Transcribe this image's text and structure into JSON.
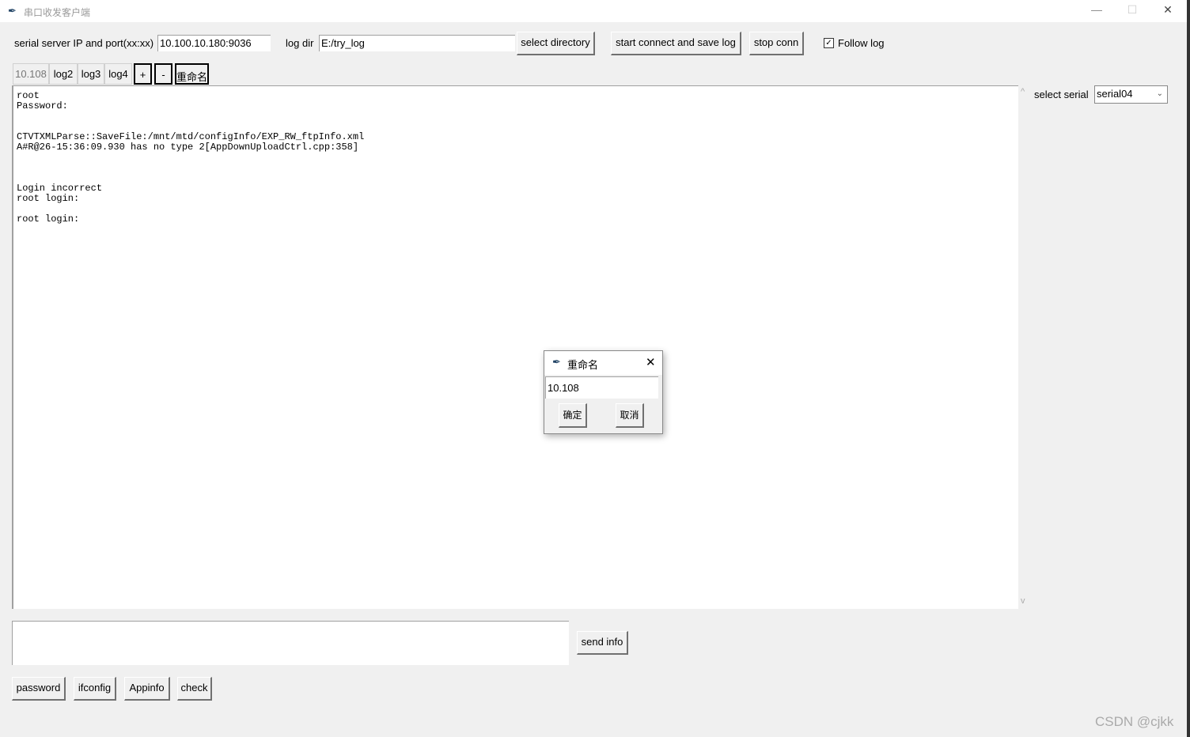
{
  "window": {
    "title": "串口收发客户端",
    "minimize": "—",
    "maximize": "☐",
    "close": "✕"
  },
  "toolbar": {
    "ip_label": "serial server IP and port(xx:xx)",
    "ip_value": "10.100.10.180:9036",
    "logdir_label": "log dir",
    "logdir_value": "E:/try_log",
    "select_directory": "select directory",
    "start_connect": "start connect and save log",
    "stop_conn": "stop conn",
    "follow_log": "Follow log",
    "follow_checked": true
  },
  "tabs": [
    {
      "label": "10.108",
      "active": true
    },
    {
      "label": "log2"
    },
    {
      "label": "log3"
    },
    {
      "label": "log4"
    }
  ],
  "tab_actions": {
    "add": "+",
    "remove": "-",
    "rename": "重命名"
  },
  "log_text": "root\nPassword:\n\n\nCTVTXMLParse::SaveFile:/mnt/mtd/configInfo/EXP_RW_ftpInfo.xml\nA#R@26-15:36:09.930 has no type 2[AppDownUploadCtrl.cpp:358]\n\n\n\nLogin incorrect\nroot login:\n\nroot login:",
  "serial": {
    "label": "select serial",
    "value": "serial04"
  },
  "send": {
    "value": "",
    "button": "send info"
  },
  "quick_buttons": [
    "password",
    "ifconfig",
    "Appinfo",
    "check"
  ],
  "dialog": {
    "title": "重命名",
    "value": "10.108",
    "ok": "确定",
    "cancel": "取消"
  },
  "watermark": "CSDN @cjkk"
}
